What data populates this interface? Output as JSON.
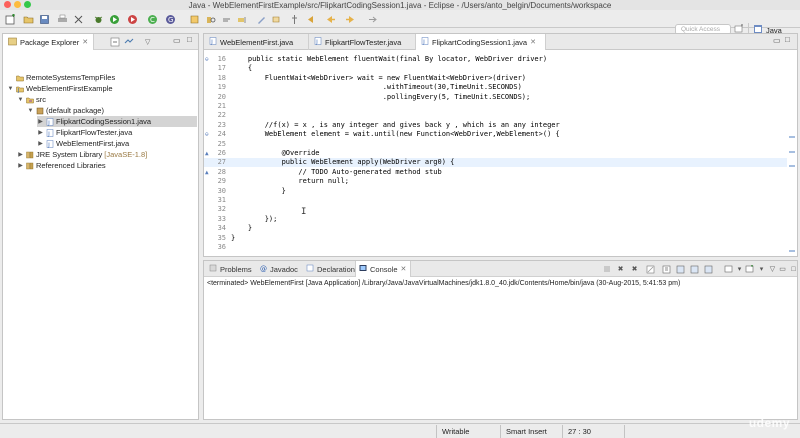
{
  "window": {
    "title": "Java - WebElementFirstExample/src/FlipkartCodingSession1.java - Eclipse - /Users/anto_belgin/Documents/workspace"
  },
  "toolbar": {
    "quick_access_placeholder": "Quick Access",
    "perspective_label": "Java"
  },
  "package_explorer": {
    "tab_label": "Package Explorer",
    "tree": [
      {
        "label": "RemoteSystemsTempFiles",
        "decoration": "",
        "icon": "folder-icon",
        "twisty": "",
        "depth": 0
      },
      {
        "label": "WebElementFirstExample",
        "decoration": "",
        "icon": "java-project-icon",
        "twisty": "▼",
        "depth": 0
      },
      {
        "label": "src",
        "decoration": "",
        "icon": "source-folder-icon",
        "twisty": "▼",
        "depth": 1
      },
      {
        "label": "(default package)",
        "decoration": "",
        "icon": "package-icon",
        "twisty": "▼",
        "depth": 2
      },
      {
        "label": "FlipkartCodingSession1.java",
        "decoration": "",
        "icon": "java-file-icon",
        "twisty": "▶",
        "depth": 3,
        "selected": true
      },
      {
        "label": "FlipkartFlowTester.java",
        "decoration": "",
        "icon": "java-file-icon",
        "twisty": "▶",
        "depth": 3
      },
      {
        "label": "WebElementFirst.java",
        "decoration": "",
        "icon": "java-file-icon",
        "twisty": "▶",
        "depth": 3
      },
      {
        "label": "JRE System Library",
        "decoration": "[JavaSE-1.8]",
        "icon": "library-icon",
        "twisty": "▶",
        "depth": 1
      },
      {
        "label": "Referenced Libraries",
        "decoration": "",
        "icon": "library-icon",
        "twisty": "▶",
        "depth": 1
      }
    ]
  },
  "editor": {
    "tabs": [
      {
        "label": "WebElementFirst.java",
        "active": false
      },
      {
        "label": "FlipkartFlowTester.java",
        "active": false
      },
      {
        "label": "FlipkartCodingSession1.java",
        "active": true
      }
    ],
    "lines": [
      {
        "num": "16",
        "text": "    public static WebElement fluentWait(final By locator, WebDriver driver)"
      },
      {
        "num": "17",
        "text": "    {"
      },
      {
        "num": "18",
        "text": "        FluentWait<WebDriver> wait = new FluentWait<WebDriver>(driver)"
      },
      {
        "num": "19",
        "text": "                                    .withTimeout(30,TimeUnit.SECONDS)"
      },
      {
        "num": "20",
        "text": "                                    .pollingEvery(5, TimeUnit.SECONDS);"
      },
      {
        "num": "21",
        "text": ""
      },
      {
        "num": "22",
        "text": ""
      },
      {
        "num": "23",
        "text": "        //f(x) = x , is any integer and gives back y , which is an any integer"
      },
      {
        "num": "24",
        "text": "        WebElement element = wait.until(new Function<WebDriver,WebElement>() {"
      },
      {
        "num": "25",
        "text": ""
      },
      {
        "num": "26",
        "text": "            @Override"
      },
      {
        "num": "27",
        "text": "            public WebElement apply(WebDriver arg0) {"
      },
      {
        "num": "28",
        "text": "                // TODO Auto-generated method stub"
      },
      {
        "num": "29",
        "text": "                return null;"
      },
      {
        "num": "30",
        "text": "            }"
      },
      {
        "num": "31",
        "text": ""
      },
      {
        "num": "32",
        "text": ""
      },
      {
        "num": "33",
        "text": "        });"
      },
      {
        "num": "34",
        "text": "    }"
      },
      {
        "num": "35",
        "text": "}"
      },
      {
        "num": "36",
        "text": ""
      }
    ]
  },
  "bottom_panel": {
    "tabs": [
      {
        "label": "Problems",
        "icon": "problems-icon",
        "active": false
      },
      {
        "label": "Javadoc",
        "icon": "javadoc-icon",
        "active": false
      },
      {
        "label": "Declaration",
        "icon": "declaration-icon",
        "active": false
      },
      {
        "label": "Console",
        "icon": "console-icon",
        "active": true
      }
    ],
    "console_text": "<terminated> WebElementFirst [Java Application] /Library/Java/JavaVirtualMachines/jdk1.8.0_40.jdk/Contents/Home/bin/java (30-Aug-2015, 5:41:53 pm)"
  },
  "status_bar": {
    "writable": "Writable",
    "insert_mode": "Smart Insert",
    "cursor_position": "27 : 30"
  },
  "watermark": "udemy"
}
